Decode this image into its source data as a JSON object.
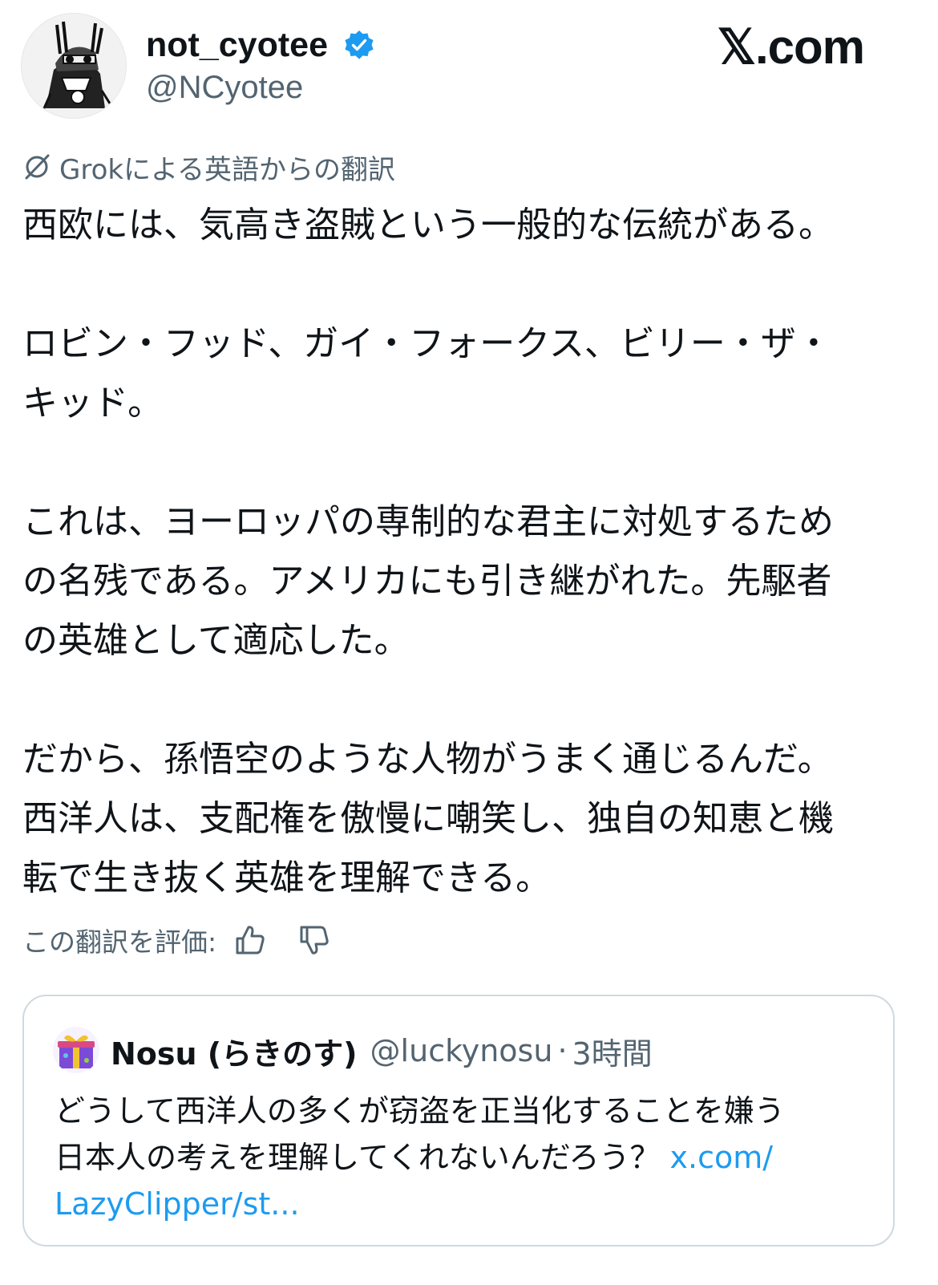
{
  "author": {
    "display_name": "not_cyotee",
    "handle": "@NCyotee",
    "verified_icon": "verified-badge-icon",
    "avatar_icon": "avatar-illustration"
  },
  "brand": {
    "label": "𝕏.com"
  },
  "translation": {
    "label": "Grokによる英語からの翻訳",
    "icon": "grok-icon"
  },
  "tweet": {
    "paragraphs": [
      [
        "西欧には、気高き盗賊という一般的な伝統がある。"
      ],
      [
        "ロビン・フッド、ガイ・フォークス、ビリー・ザ・",
        "キッド。"
      ],
      [
        "これは、ヨーロッパの専制的な君主に対処するため",
        "の名残である。アメリカにも引き継がれた。先駆者",
        "の英雄として適応した。"
      ],
      [
        "だから、孫悟空のような人物がうまく通じるんだ。",
        "西洋人は、支配権を傲慢に嘲笑し、独自の知恵と機",
        "転で生き抜く英雄を理解できる。"
      ]
    ]
  },
  "rating": {
    "label": "この翻訳を評価:",
    "up_icon": "thumbs-up-icon",
    "down_icon": "thumbs-down-icon"
  },
  "quoted": {
    "name": "Nosu (らきのす)",
    "handle": "@luckynosu",
    "separator": "·",
    "time": "3時間",
    "text_lines": [
      "どうして西洋人の多くが窃盗を正当化することを嫌う",
      "日本人の考えを理解してくれないんだろう？ "
    ],
    "link_part1": "x.com/",
    "link_part2": "LazyClipper/st...",
    "avatar_icon": "gift-box-avatar"
  },
  "colors": {
    "text": "#0f1419",
    "secondary": "#536471",
    "link": "#1d9bf0",
    "verified": "#1d9bf0",
    "border": "#cfd9de"
  }
}
